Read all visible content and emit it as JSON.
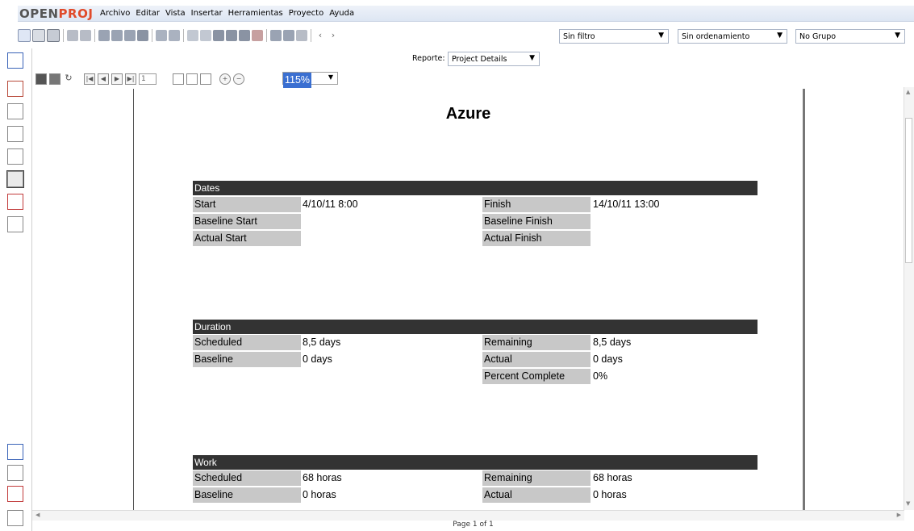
{
  "app": {
    "logo_part1": "OPEN",
    "logo_part2": "PROJ",
    "menus": [
      "Archivo",
      "Editar",
      "Vista",
      "Insertar",
      "Herramientas",
      "Proyecto",
      "Ayuda"
    ]
  },
  "filters": {
    "filter_value": "Sin filtro",
    "sort_value": "Sin ordenamiento",
    "group_value": "No Grupo"
  },
  "report": {
    "label": "Reporte:",
    "value": "Project Details"
  },
  "viewer": {
    "page_number": "1",
    "zoom": "115%"
  },
  "document": {
    "title": "Azure",
    "sections": {
      "dates": {
        "header": "Dates",
        "start_label": "Start",
        "start_value": "4/10/11 8:00",
        "finish_label": "Finish",
        "finish_value": "14/10/11 13:00",
        "baseline_start_label": "Baseline Start",
        "baseline_finish_label": "Baseline Finish",
        "actual_start_label": "Actual Start",
        "actual_finish_label": "Actual Finish"
      },
      "duration": {
        "header": "Duration",
        "scheduled_label": "Scheduled",
        "scheduled_value": "8,5 days",
        "remaining_label": "Remaining",
        "remaining_value": "8,5 days",
        "baseline_label": "Baseline",
        "baseline_value": "0 days",
        "actual_label": "Actual",
        "actual_value": "0 days",
        "percent_label": "Percent Complete",
        "percent_value": "0%"
      },
      "work": {
        "header": "Work",
        "scheduled_label": "Scheduled",
        "scheduled_value": "68 horas",
        "remaining_label": "Remaining",
        "remaining_value": "68 horas",
        "baseline_label": "Baseline",
        "baseline_value": "0 horas",
        "actual_label": "Actual",
        "actual_value": "0 horas"
      }
    }
  },
  "status": {
    "page_info": "Page 1 of 1"
  },
  "colors": {
    "section_header_bg": "#333333",
    "label_bg": "#c8c8c8",
    "logo_accent": "#e04a2a",
    "zoom_highlight": "#3a6fd1"
  }
}
